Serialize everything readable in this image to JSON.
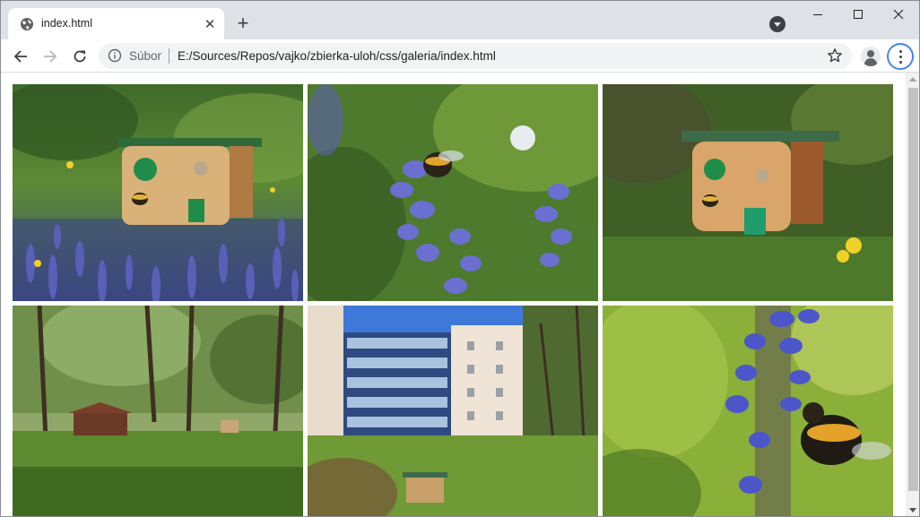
{
  "tab": {
    "title": "index.html",
    "icon": "globe-icon"
  },
  "address_bar": {
    "scheme_label": "Súbor",
    "url": "E:/Sources/Repos/vajko/zbierka-uloh/css/galeria/index.html"
  },
  "gallery": {
    "photos": [
      {
        "subject": "wooden insect house with bee sticker in blue flower meadow",
        "icon": "photo-icon"
      },
      {
        "subject": "bumblebee on blue bugle flowers",
        "icon": "photo-icon"
      },
      {
        "subject": "wooden insect house in green grass with yellow flowers",
        "icon": "photo-icon"
      },
      {
        "subject": "garden with trees and wooden gazebo",
        "icon": "photo-icon"
      },
      {
        "subject": "university building with glass facade and insect house on lawn",
        "icon": "photo-icon"
      },
      {
        "subject": "close-up of bumblebee on blue flower",
        "icon": "photo-icon"
      }
    ]
  },
  "colors": {
    "tabstrip": "#dee1e6",
    "omnibox": "#f1f3f4",
    "accent": "#4285f4"
  }
}
